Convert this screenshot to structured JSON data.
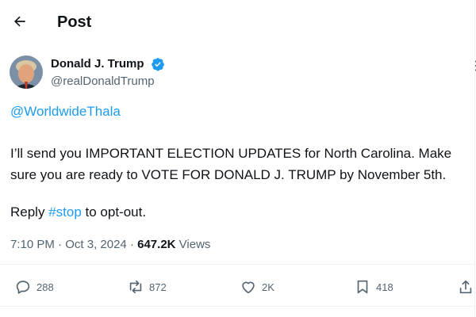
{
  "header": {
    "title": "Post"
  },
  "author": {
    "name": "Donald J. Trump",
    "handle": "@realDonaldTrump",
    "verified_color": "#1d9bf0"
  },
  "post": {
    "mention": "@WorldwideThala",
    "lines": [
      "I’ll send you IMPORTANT ELECTION UPDATES for North Carolina. Make",
      "sure you are ready to VOTE FOR DONALD J. TRUMP by November 5th."
    ],
    "reply_prefix": "Reply ",
    "reply_hashtag": "#stop",
    "reply_suffix": " to opt-out."
  },
  "meta": {
    "time": "7:10 PM",
    "separator": " · ",
    "date": "Oct 3, 2024",
    "views_count": "647.2K",
    "views_label": " Views"
  },
  "actions": {
    "replies": "288",
    "reposts": "872",
    "likes": "2K",
    "bookmarks": "418"
  },
  "colors": {
    "accent": "#1d9bf0",
    "text": "#0f1419",
    "muted": "#536471"
  },
  "icons": [
    "back-arrow-icon",
    "verified-badge-icon",
    "more-icon",
    "reply-icon",
    "repost-icon",
    "like-icon",
    "bookmark-icon",
    "share-icon"
  ]
}
